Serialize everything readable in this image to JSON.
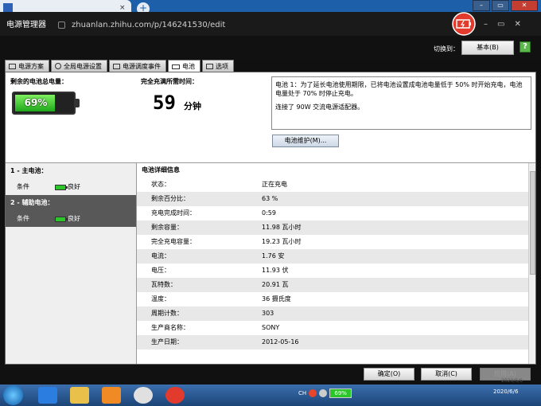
{
  "browser": {
    "tab_close": "×",
    "new_tab": "+",
    "window_controls": [
      "–",
      "▭",
      "✕"
    ]
  },
  "app": {
    "title": "电源管理器",
    "url": "zhuanlan.zhihu.com/p/146241530/edit",
    "window_controls": [
      "–",
      "▭",
      "✕"
    ],
    "switch_label": "切换到：",
    "switch_button": "基本(B)",
    "help": "?"
  },
  "tabs": [
    {
      "label": "电源方案",
      "icon": "page-icon"
    },
    {
      "label": "全局电源设置",
      "icon": "gear-icon"
    },
    {
      "label": "电源调度事件",
      "icon": "page-icon"
    },
    {
      "label": "电池",
      "icon": "battery-icon"
    },
    {
      "label": "选项",
      "icon": "check-icon"
    }
  ],
  "summary": {
    "remaining_label": "剩余的电池总电量：",
    "percent_text": "69%",
    "percent": 69,
    "charge_label": "完全充满所需时间：",
    "charge_time": "59",
    "charge_unit": "分钟",
    "info_line1": "电池 1：为了延长电池使用期限，已将电池设置成电池电量低于 50% 时开始充电，电池电量处于 70% 时停止充电。",
    "info_line2": "连接了 90W 交流电源适配器。",
    "maintenance_button": "电池维护(M)..."
  },
  "batteries": [
    {
      "header": "1 - 主电池：",
      "cond_label": "条件",
      "status": "良好"
    },
    {
      "header": "2 - 辅助电池：",
      "cond_label": "条件",
      "status": "良好"
    }
  ],
  "details": {
    "title": "电池详细信息",
    "rows": [
      {
        "k": "状态：",
        "v": "正在充电"
      },
      {
        "k": "剩余百分比：",
        "v": "63 %"
      },
      {
        "k": "充电完成时间：",
        "v": "0:59"
      },
      {
        "k": "剩余容量：",
        "v": "11.98 瓦小时"
      },
      {
        "k": "完全充电容量：",
        "v": "19.23 瓦小时"
      },
      {
        "k": "电流：",
        "v": "1.76 安"
      },
      {
        "k": "电压：",
        "v": "11.93 伏"
      },
      {
        "k": "瓦特数：",
        "v": "20.91 瓦"
      },
      {
        "k": "温度：",
        "v": "36 摄氏度"
      },
      {
        "k": "周期计数：",
        "v": "303"
      },
      {
        "k": "生产商名称：",
        "v": "SONY"
      },
      {
        "k": "生产日期：",
        "v": "2012-05-16"
      }
    ]
  },
  "footer": {
    "ok": "确定(O)",
    "cancel": "取消(C)",
    "apply": "应用(A)",
    "watermark_date": "2020/6/6"
  },
  "taskbar": {
    "lang": "CH",
    "tray_battery": "69%",
    "clock_date": "2020/6/6"
  },
  "colors": {
    "battery_green": "#2cc52a",
    "window_bg": "#101010",
    "taskbar": "#1c4476"
  }
}
